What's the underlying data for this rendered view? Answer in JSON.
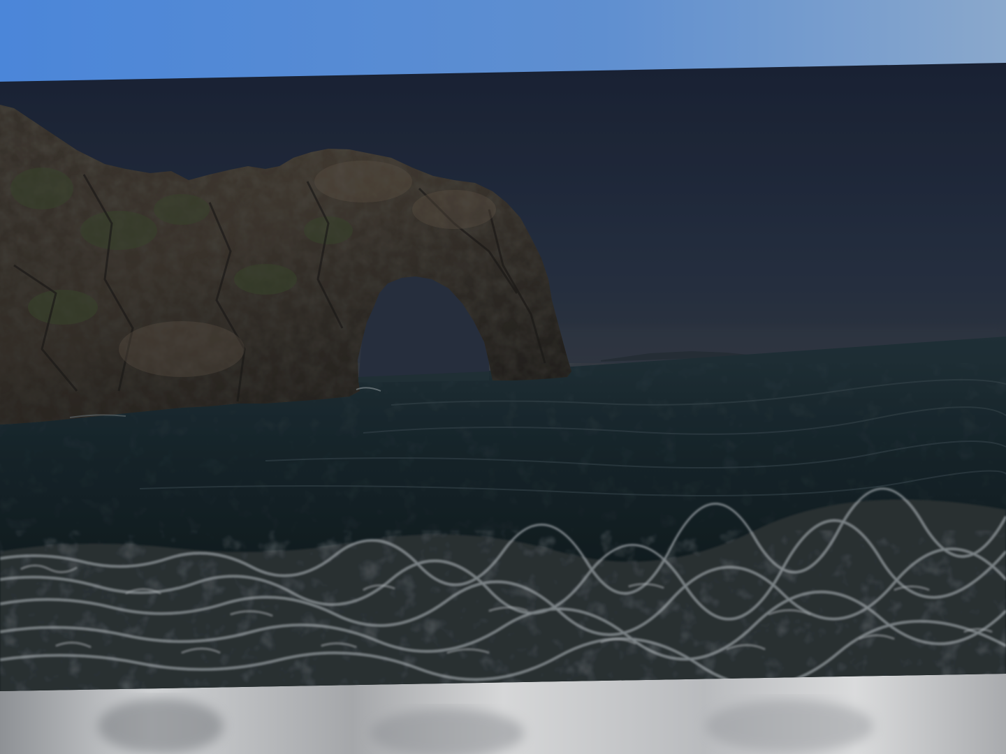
{
  "scene": {
    "description_visible_text": "",
    "colors": {
      "sky_blue_top": "#4f8ad8",
      "sky_blue_right": "#7fa3cf",
      "photo_sky_dark": "#1d2535",
      "photo_sky_horizon": "#2e3644",
      "sea_far": "#1f2d33",
      "sea_near": "#0f1718",
      "rock_dark": "#2a2622",
      "rock_mid": "#4a4035",
      "foam": "#b8bfc2",
      "bottom_blur_light": "#c9cbce",
      "bottom_blur_dark": "#8d9094"
    },
    "icons": []
  }
}
